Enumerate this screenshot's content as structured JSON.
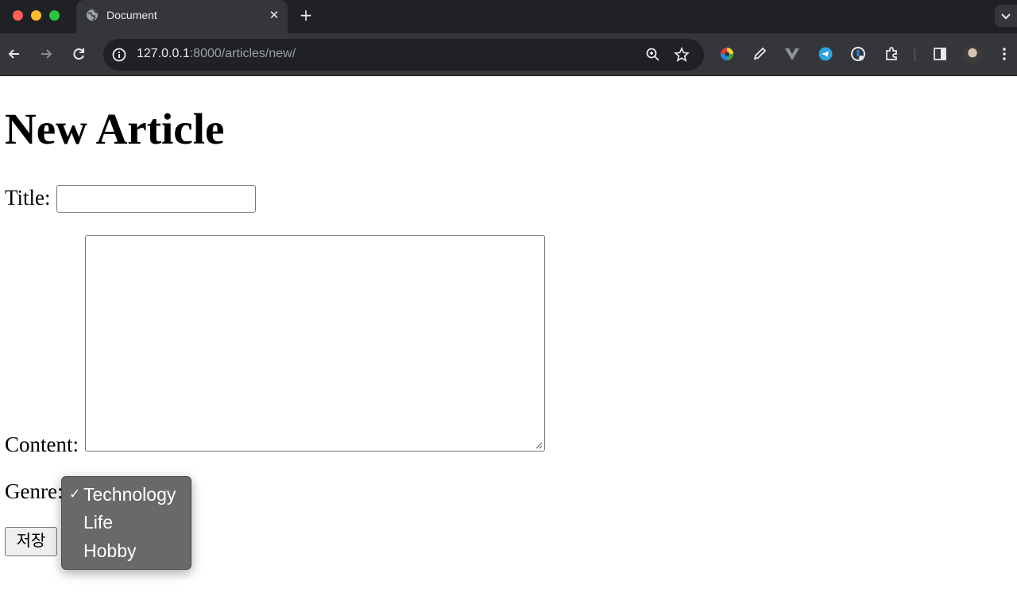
{
  "browser": {
    "tab_title": "Document",
    "tab_close": "✕",
    "new_tab": "+",
    "url_host": "127.0.0.1",
    "url_rest": ":8000/articles/new/",
    "extension_icons": [
      "color-wheel-icon",
      "eyedropper-icon",
      "vue-devtools-icon",
      "telegram-icon",
      "password-manager-icon",
      "puzzle-extensions-icon"
    ]
  },
  "page": {
    "heading": "New Article",
    "title_label": "Title:",
    "title_value": "",
    "content_label": "Content:",
    "content_value": "",
    "genre_label": "Genre:",
    "save_label": "저장"
  },
  "genre_select": {
    "options": [
      {
        "label": "Technology",
        "selected": true,
        "check": "✓"
      },
      {
        "label": "Life",
        "selected": false,
        "check": ""
      },
      {
        "label": "Hobby",
        "selected": false,
        "check": ""
      }
    ]
  }
}
